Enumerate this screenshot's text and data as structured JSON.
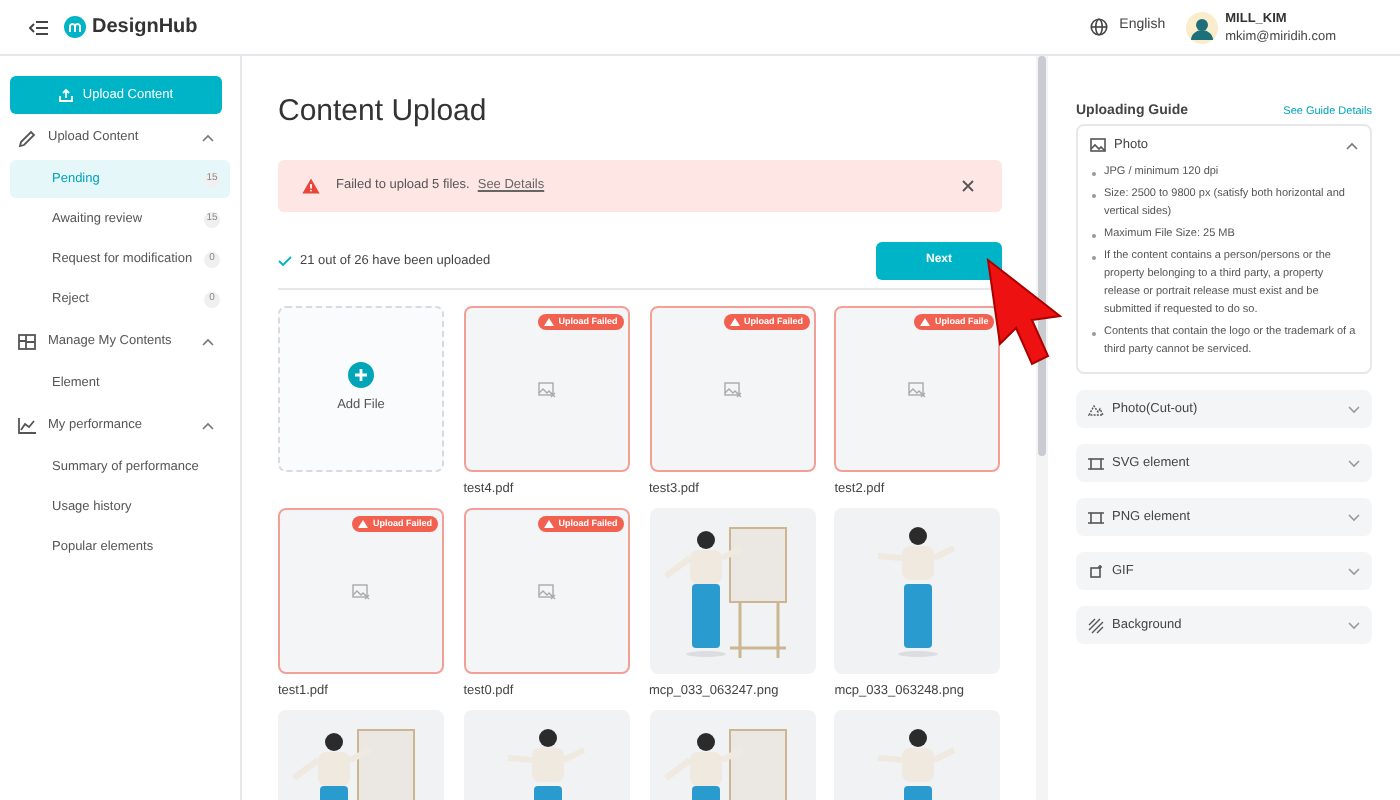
{
  "header": {
    "logo": "DesignHub",
    "language": "English",
    "user_name": "MILL_KIM",
    "user_email": "mkim@miridih.com"
  },
  "sidebar": {
    "upload_button": "Upload Content",
    "groups": [
      {
        "label": "Upload Content",
        "expanded": true,
        "items": [
          {
            "label": "Pending",
            "count": "15",
            "selected": true
          },
          {
            "label": "Awaiting review",
            "count": "15",
            "selected": false
          },
          {
            "label": "Request for modification",
            "count": "0",
            "selected": false
          },
          {
            "label": "Reject",
            "count": "0",
            "selected": false
          }
        ]
      },
      {
        "label": "Manage My Contents",
        "expanded": true,
        "items": [
          {
            "label": "Element",
            "selected": false
          }
        ]
      },
      {
        "label": "My performance",
        "expanded": true,
        "items": [
          {
            "label": "Summary of performance",
            "selected": false
          },
          {
            "label": "Usage history",
            "selected": false
          },
          {
            "label": "Popular elements",
            "selected": false
          }
        ]
      }
    ]
  },
  "main": {
    "title": "Content Upload",
    "alert": {
      "message": "Failed to upload 5 files.",
      "link": "See Details"
    },
    "status": "21 out of 26 have been uploaded",
    "next_button": "Next",
    "files": [
      {
        "kind": "add",
        "label": "Add File"
      },
      {
        "kind": "failed",
        "badge": "Upload Failed",
        "name": "test4.pdf"
      },
      {
        "kind": "failed",
        "badge": "Upload Failed",
        "name": "test3.pdf"
      },
      {
        "kind": "failed",
        "badge": "Upload Faile",
        "name": "test2.pdf"
      },
      {
        "kind": "failed",
        "badge": "Upload Failed",
        "name": "test1.pdf"
      },
      {
        "kind": "failed",
        "badge": "Upload Failed",
        "name": "test0.pdf"
      },
      {
        "kind": "picture",
        "name": "mcp_033_063247.png"
      },
      {
        "kind": "picture",
        "name": "mcp_033_063248.png"
      },
      {
        "kind": "picture"
      },
      {
        "kind": "picture"
      },
      {
        "kind": "picture"
      },
      {
        "kind": "picture"
      }
    ]
  },
  "guide": {
    "title": "Uploading Guide",
    "link": "See Guide Details",
    "sections": [
      {
        "title": "Photo",
        "expanded": true,
        "bullets": [
          "JPG / minimum 120 dpi",
          "Size: 2500 to 9800 px (satisfy both horizontal and vertical sides)",
          "Maximum File Size: 25 MB",
          "If the content contains a person/persons or the property belonging to a third party, a property release or portrait release must exist and be submitted if requested to do so.",
          "Contents that contain the logo or the trademark of a third party cannot be serviced."
        ]
      },
      {
        "title": "Photo(Cut-out)",
        "expanded": false
      },
      {
        "title": "SVG element",
        "expanded": false
      },
      {
        "title": "PNG element",
        "expanded": false
      },
      {
        "title": "GIF",
        "expanded": false
      },
      {
        "title": "Background",
        "expanded": false
      }
    ]
  }
}
